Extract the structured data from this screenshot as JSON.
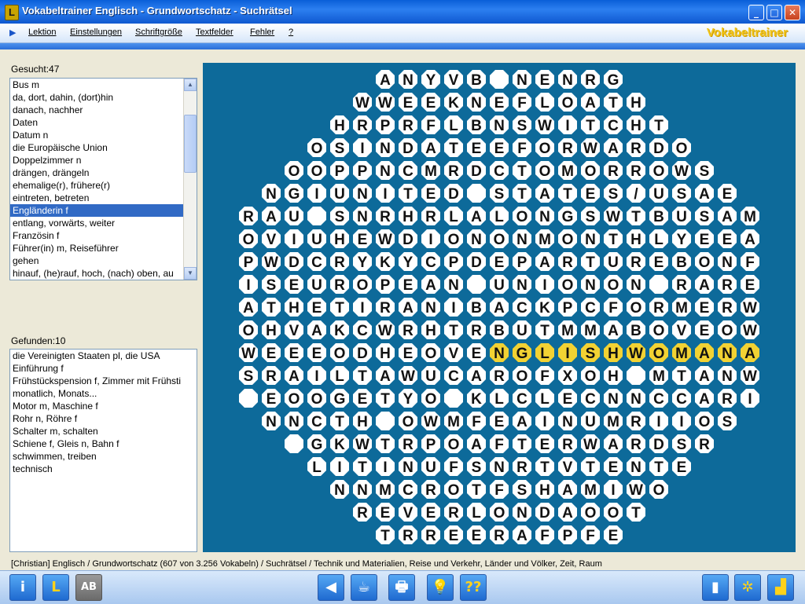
{
  "window": {
    "title": "Vokabeltrainer Englisch - Grundwortschatz - Suchrätsel",
    "app_icon": "L",
    "buttons": [
      "_",
      "□",
      "✕"
    ]
  },
  "menu": {
    "items": [
      "Lektion",
      "Einstellungen",
      "Schriftgröße",
      "Textfelder",
      "Fehler",
      "?"
    ],
    "brand": "Vokabeltrainer"
  },
  "gesucht": {
    "label": "Gesucht:47",
    "items": [
      "Bus m",
      "da, dort, dahin, (dort)hin",
      "danach, nachher",
      "Daten",
      "Datum n",
      "die Europäische Union",
      "Doppelzimmer n",
      "drängen, drängeln",
      "ehemalige(r), frühere(r)",
      "eintreten, betreten",
      "Engländerin f",
      "entlang, vorwärts, weiter",
      "Französin f",
      "Führer(in) m, Reiseführer",
      "gehen",
      "hinauf, (he)rauf, hoch, (nach) oben, au"
    ],
    "selected_index": 10
  },
  "gefunden": {
    "label": "Gefunden:10",
    "items": [
      "die Vereinigten Staaten pl, die USA",
      "Einführung f",
      "Frühstückspension f, Zimmer mit Frühsti",
      "monatlich, Monats...",
      "Motor m, Maschine f",
      "Rohr n, Röhre f",
      "Schalter m, schalten",
      "Schiene f, Gleis n, Bahn f",
      "schwimmen, treiben",
      "technisch"
    ]
  },
  "puzzle": {
    "colors": {
      "board": "#0d6a9a",
      "cell": "#ffffff",
      "highlight": "#f2d233",
      "found": "#c8c8c8"
    },
    "rows": [
      "ANYVB NENRG",
      "WWEEKNEFLOATH",
      "HRPRFLBNSWITCHT",
      "OSINDATEEFORWARDO",
      "OOPPNCMRDCTOMORROWS",
      "NGIUNITED STATES/USAE",
      "RAU SNRHRLALONGSWTBUSAM",
      "OVIUHEWDIONONMONTHLYEEA",
      "PWDCRYKYCPDEPARTUREBONF",
      "ISEUROPEAN UNIONON RARE",
      "ATHETIRANIBACKPCFORMERW",
      "OHVAKCWRHTRBUTMMABOVEOW",
      "WEEEODHEOVENGLISHWOMANA",
      "SRAILTAWUCAROFXOH MTANW",
      " EOOGETYO KLCLECNNCCARI",
      "NNCTH OWMFEAINUMRIIOS",
      " GKWTRPOAFTERWARDSR",
      "LITINUFSNRTVTENTE",
      "NNMCROTFSHAMIWO",
      "REVERLONDAOOT",
      "TRREERAFPFE"
    ],
    "found_word": "ENGLISHWOMAN",
    "found_row": 12,
    "found_start": 11
  },
  "status": {
    "text": "[Christian]  Englisch / Grundwortschatz  (607 von 3.256 Vokabeln) / Suchrätsel / Technik und Materialien, Reise und Verkehr, Länder und Völker, Zeit, Raum"
  },
  "toolbar": {
    "left": [
      "i",
      "L",
      "AB"
    ],
    "middle": [
      "◀",
      "☕",
      "🖶",
      "💡",
      "??"
    ],
    "right": [
      "▮",
      "✲",
      "▟"
    ]
  }
}
